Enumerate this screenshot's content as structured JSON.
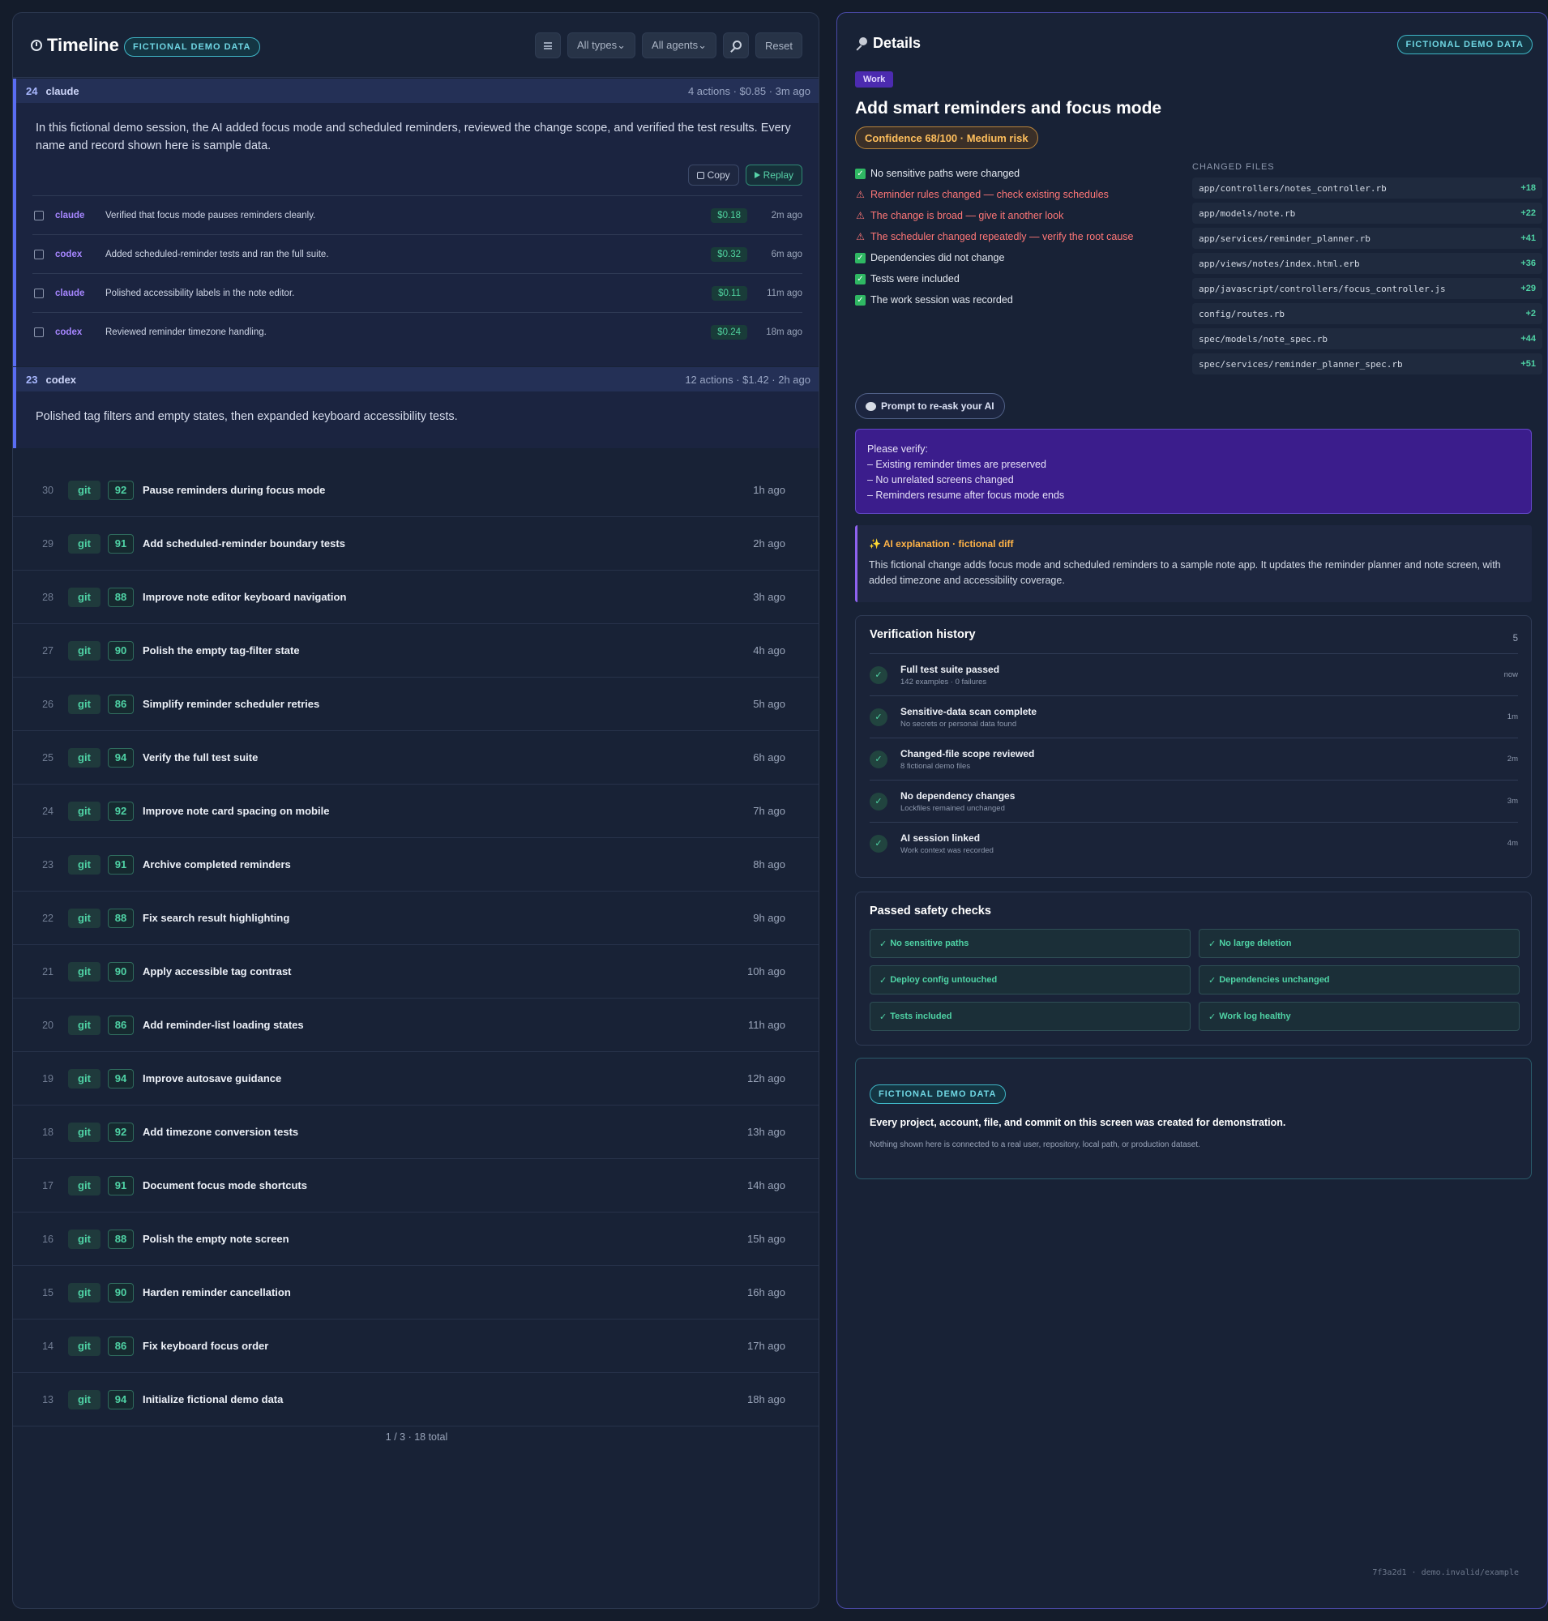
{
  "timeline": {
    "title": "Timeline",
    "demo_badge": "FICTIONAL DEMO DATA",
    "filters": {
      "types": "All types⌄",
      "agents": "All agents⌄",
      "reset": "Reset"
    },
    "sessions": [
      {
        "num": "24",
        "agent": "claude",
        "meta": "4 actions · $0.85 · 3m ago",
        "summary": "In this fictional demo session, the AI added focus mode and scheduled reminders, reviewed the change scope, and verified the test results. Every name and record shown here is sample data.",
        "copy_label": "Copy",
        "replay_label": "Replay",
        "actions": [
          {
            "agent": "claude",
            "text": "Verified that focus mode pauses reminders cleanly.",
            "cost": "$0.18",
            "time": "2m ago"
          },
          {
            "agent": "codex",
            "text": "Added scheduled-reminder tests and ran the full suite.",
            "cost": "$0.32",
            "time": "6m ago"
          },
          {
            "agent": "claude",
            "text": "Polished accessibility labels in the note editor.",
            "cost": "$0.11",
            "time": "11m ago"
          },
          {
            "agent": "codex",
            "text": "Reviewed reminder timezone handling.",
            "cost": "$0.24",
            "time": "18m ago"
          }
        ]
      },
      {
        "num": "23",
        "agent": "codex",
        "meta": "12 actions · $1.42 · 2h ago",
        "summary": "Polished tag filters and empty states, then expanded keyboard accessibility tests."
      }
    ],
    "commits": [
      {
        "num": "30",
        "type": "git",
        "score": "92",
        "title": "Pause reminders during focus mode",
        "time": "1h ago"
      },
      {
        "num": "29",
        "type": "git",
        "score": "91",
        "title": "Add scheduled-reminder boundary tests",
        "time": "2h ago"
      },
      {
        "num": "28",
        "type": "git",
        "score": "88",
        "title": "Improve note editor keyboard navigation",
        "time": "3h ago"
      },
      {
        "num": "27",
        "type": "git",
        "score": "90",
        "title": "Polish the empty tag-filter state",
        "time": "4h ago"
      },
      {
        "num": "26",
        "type": "git",
        "score": "86",
        "title": "Simplify reminder scheduler retries",
        "time": "5h ago"
      },
      {
        "num": "25",
        "type": "git",
        "score": "94",
        "title": "Verify the full test suite",
        "time": "6h ago"
      },
      {
        "num": "24",
        "type": "git",
        "score": "92",
        "title": "Improve note card spacing on mobile",
        "time": "7h ago"
      },
      {
        "num": "23",
        "type": "git",
        "score": "91",
        "title": "Archive completed reminders",
        "time": "8h ago"
      },
      {
        "num": "22",
        "type": "git",
        "score": "88",
        "title": "Fix search result highlighting",
        "time": "9h ago"
      },
      {
        "num": "21",
        "type": "git",
        "score": "90",
        "title": "Apply accessible tag contrast",
        "time": "10h ago"
      },
      {
        "num": "20",
        "type": "git",
        "score": "86",
        "title": "Add reminder-list loading states",
        "time": "11h ago"
      },
      {
        "num": "19",
        "type": "git",
        "score": "94",
        "title": "Improve autosave guidance",
        "time": "12h ago"
      },
      {
        "num": "18",
        "type": "git",
        "score": "92",
        "title": "Add timezone conversion tests",
        "time": "13h ago"
      },
      {
        "num": "17",
        "type": "git",
        "score": "91",
        "title": "Document focus mode shortcuts",
        "time": "14h ago"
      },
      {
        "num": "16",
        "type": "git",
        "score": "88",
        "title": "Polish the empty note screen",
        "time": "15h ago"
      },
      {
        "num": "15",
        "type": "git",
        "score": "90",
        "title": "Harden reminder cancellation",
        "time": "16h ago"
      },
      {
        "num": "14",
        "type": "git",
        "score": "86",
        "title": "Fix keyboard focus order",
        "time": "17h ago"
      },
      {
        "num": "13",
        "type": "git",
        "score": "94",
        "title": "Initialize fictional demo data",
        "time": "18h ago"
      }
    ],
    "pager": "1 / 3  ·  18 total"
  },
  "details": {
    "title": "Details",
    "demo_badge": "FICTIONAL DEMO DATA",
    "tag": "Work",
    "heading": "Add smart reminders and focus mode",
    "confidence": "Confidence 68/100 · Medium risk",
    "checks": [
      {
        "kind": "ok",
        "text": "No sensitive paths were changed"
      },
      {
        "kind": "warn",
        "text": "Reminder rules changed — check existing schedules"
      },
      {
        "kind": "warn",
        "text": "The change is broad — give it another look"
      },
      {
        "kind": "warn",
        "text": "The scheduler changed repeatedly — verify the root cause"
      },
      {
        "kind": "ok",
        "text": "Dependencies did not change"
      },
      {
        "kind": "ok",
        "text": "Tests were included"
      },
      {
        "kind": "ok",
        "text": "The work session was recorded"
      }
    ],
    "files_label": "CHANGED FILES",
    "files": [
      {
        "path": "app/controllers/notes_controller.rb",
        "added": "+18"
      },
      {
        "path": "app/models/note.rb",
        "added": "+22"
      },
      {
        "path": "app/services/reminder_planner.rb",
        "added": "+41"
      },
      {
        "path": "app/views/notes/index.html.erb",
        "added": "+36"
      },
      {
        "path": "app/javascript/controllers/focus_controller.js",
        "added": "+29"
      },
      {
        "path": "config/routes.rb",
        "added": "+2"
      },
      {
        "path": "spec/models/note_spec.rb",
        "added": "+44"
      },
      {
        "path": "spec/services/reminder_planner_spec.rb",
        "added": "+51"
      }
    ],
    "prompt_button": "Prompt to re-ask your AI",
    "verify_lines": [
      "Please verify:",
      "– Existing reminder times are preserved",
      "– No unrelated screens changed",
      "– Reminders resume after focus mode ends"
    ],
    "explain_title": "✨ AI explanation · fictional diff",
    "explain_text": "This fictional change adds focus mode and scheduled reminders to a sample note app. It updates the reminder planner and note screen, with added timezone and accessibility coverage.",
    "verification": {
      "title": "Verification history",
      "count": "5",
      "items": [
        {
          "title": "Full test suite passed",
          "sub": "142 examples · 0 failures",
          "time": "now"
        },
        {
          "title": "Sensitive-data scan complete",
          "sub": "No secrets or personal data found",
          "time": "1m"
        },
        {
          "title": "Changed-file scope reviewed",
          "sub": "8 fictional demo files",
          "time": "2m"
        },
        {
          "title": "No dependency changes",
          "sub": "Lockfiles remained unchanged",
          "time": "3m"
        },
        {
          "title": "AI session linked",
          "sub": "Work context was recorded",
          "time": "4m"
        }
      ]
    },
    "safety": {
      "title": "Passed safety checks",
      "items": [
        "No sensitive paths",
        "No large deletion",
        "Deploy config untouched",
        "Dependencies unchanged",
        "Tests included",
        "Work log healthy"
      ]
    },
    "notice": {
      "badge": "FICTIONAL DEMO DATA",
      "title": "Every project, account, file, and commit on this screen was created for demonstration.",
      "sub": "Nothing shown here is connected to a real user, repository, local path, or production dataset."
    },
    "footer": "7f3a2d1  ·  demo.invalid/example"
  }
}
